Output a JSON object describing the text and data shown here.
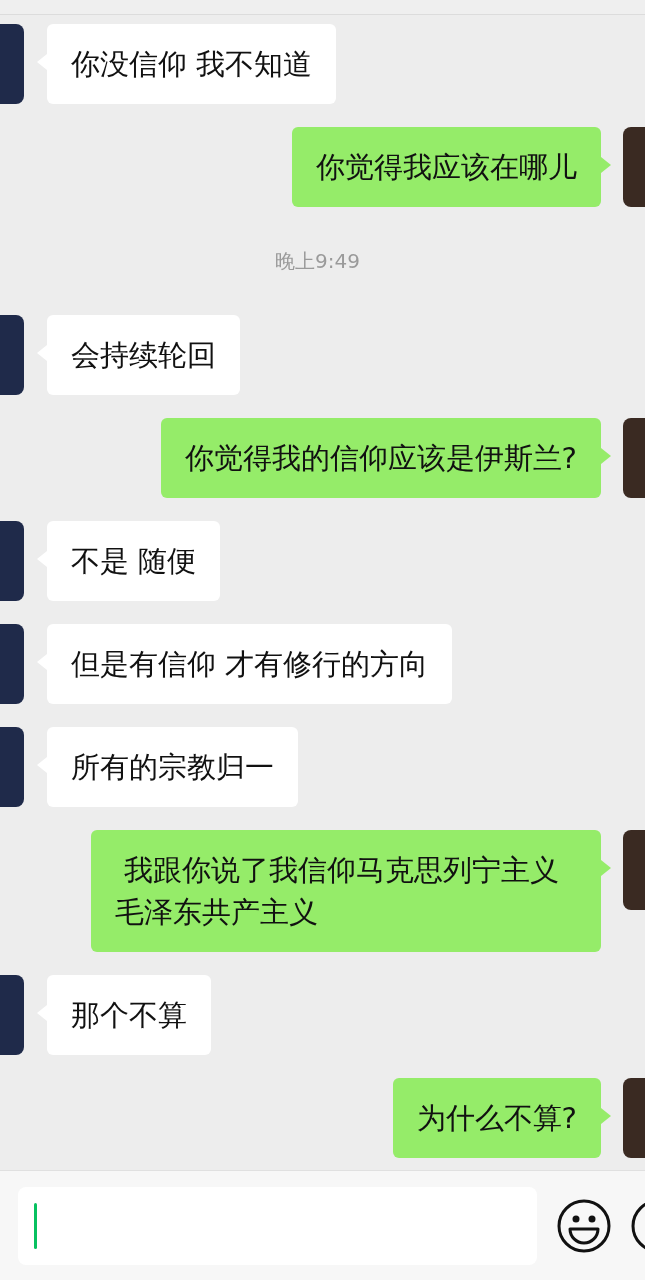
{
  "messages": [
    {
      "kind": "received",
      "text": "你没信仰 我不知道"
    },
    {
      "kind": "sent",
      "text": "你觉得我应该在哪儿"
    },
    {
      "kind": "time",
      "text": "晚上9:49"
    },
    {
      "kind": "received",
      "text": "会持续轮回"
    },
    {
      "kind": "sent",
      "text": "你觉得我的信仰应该是伊斯兰?"
    },
    {
      "kind": "received",
      "text": "不是 随便"
    },
    {
      "kind": "received",
      "text": "但是有信仰 才有修行的方向"
    },
    {
      "kind": "received",
      "text": "所有的宗教归一"
    },
    {
      "kind": "sent",
      "text": " 我跟你说了我信仰马克思列宁主义毛泽东共产主义"
    },
    {
      "kind": "received",
      "text": "那个不算"
    },
    {
      "kind": "sent",
      "text": "为什么不算?"
    }
  ],
  "composer": {
    "focused": true
  }
}
